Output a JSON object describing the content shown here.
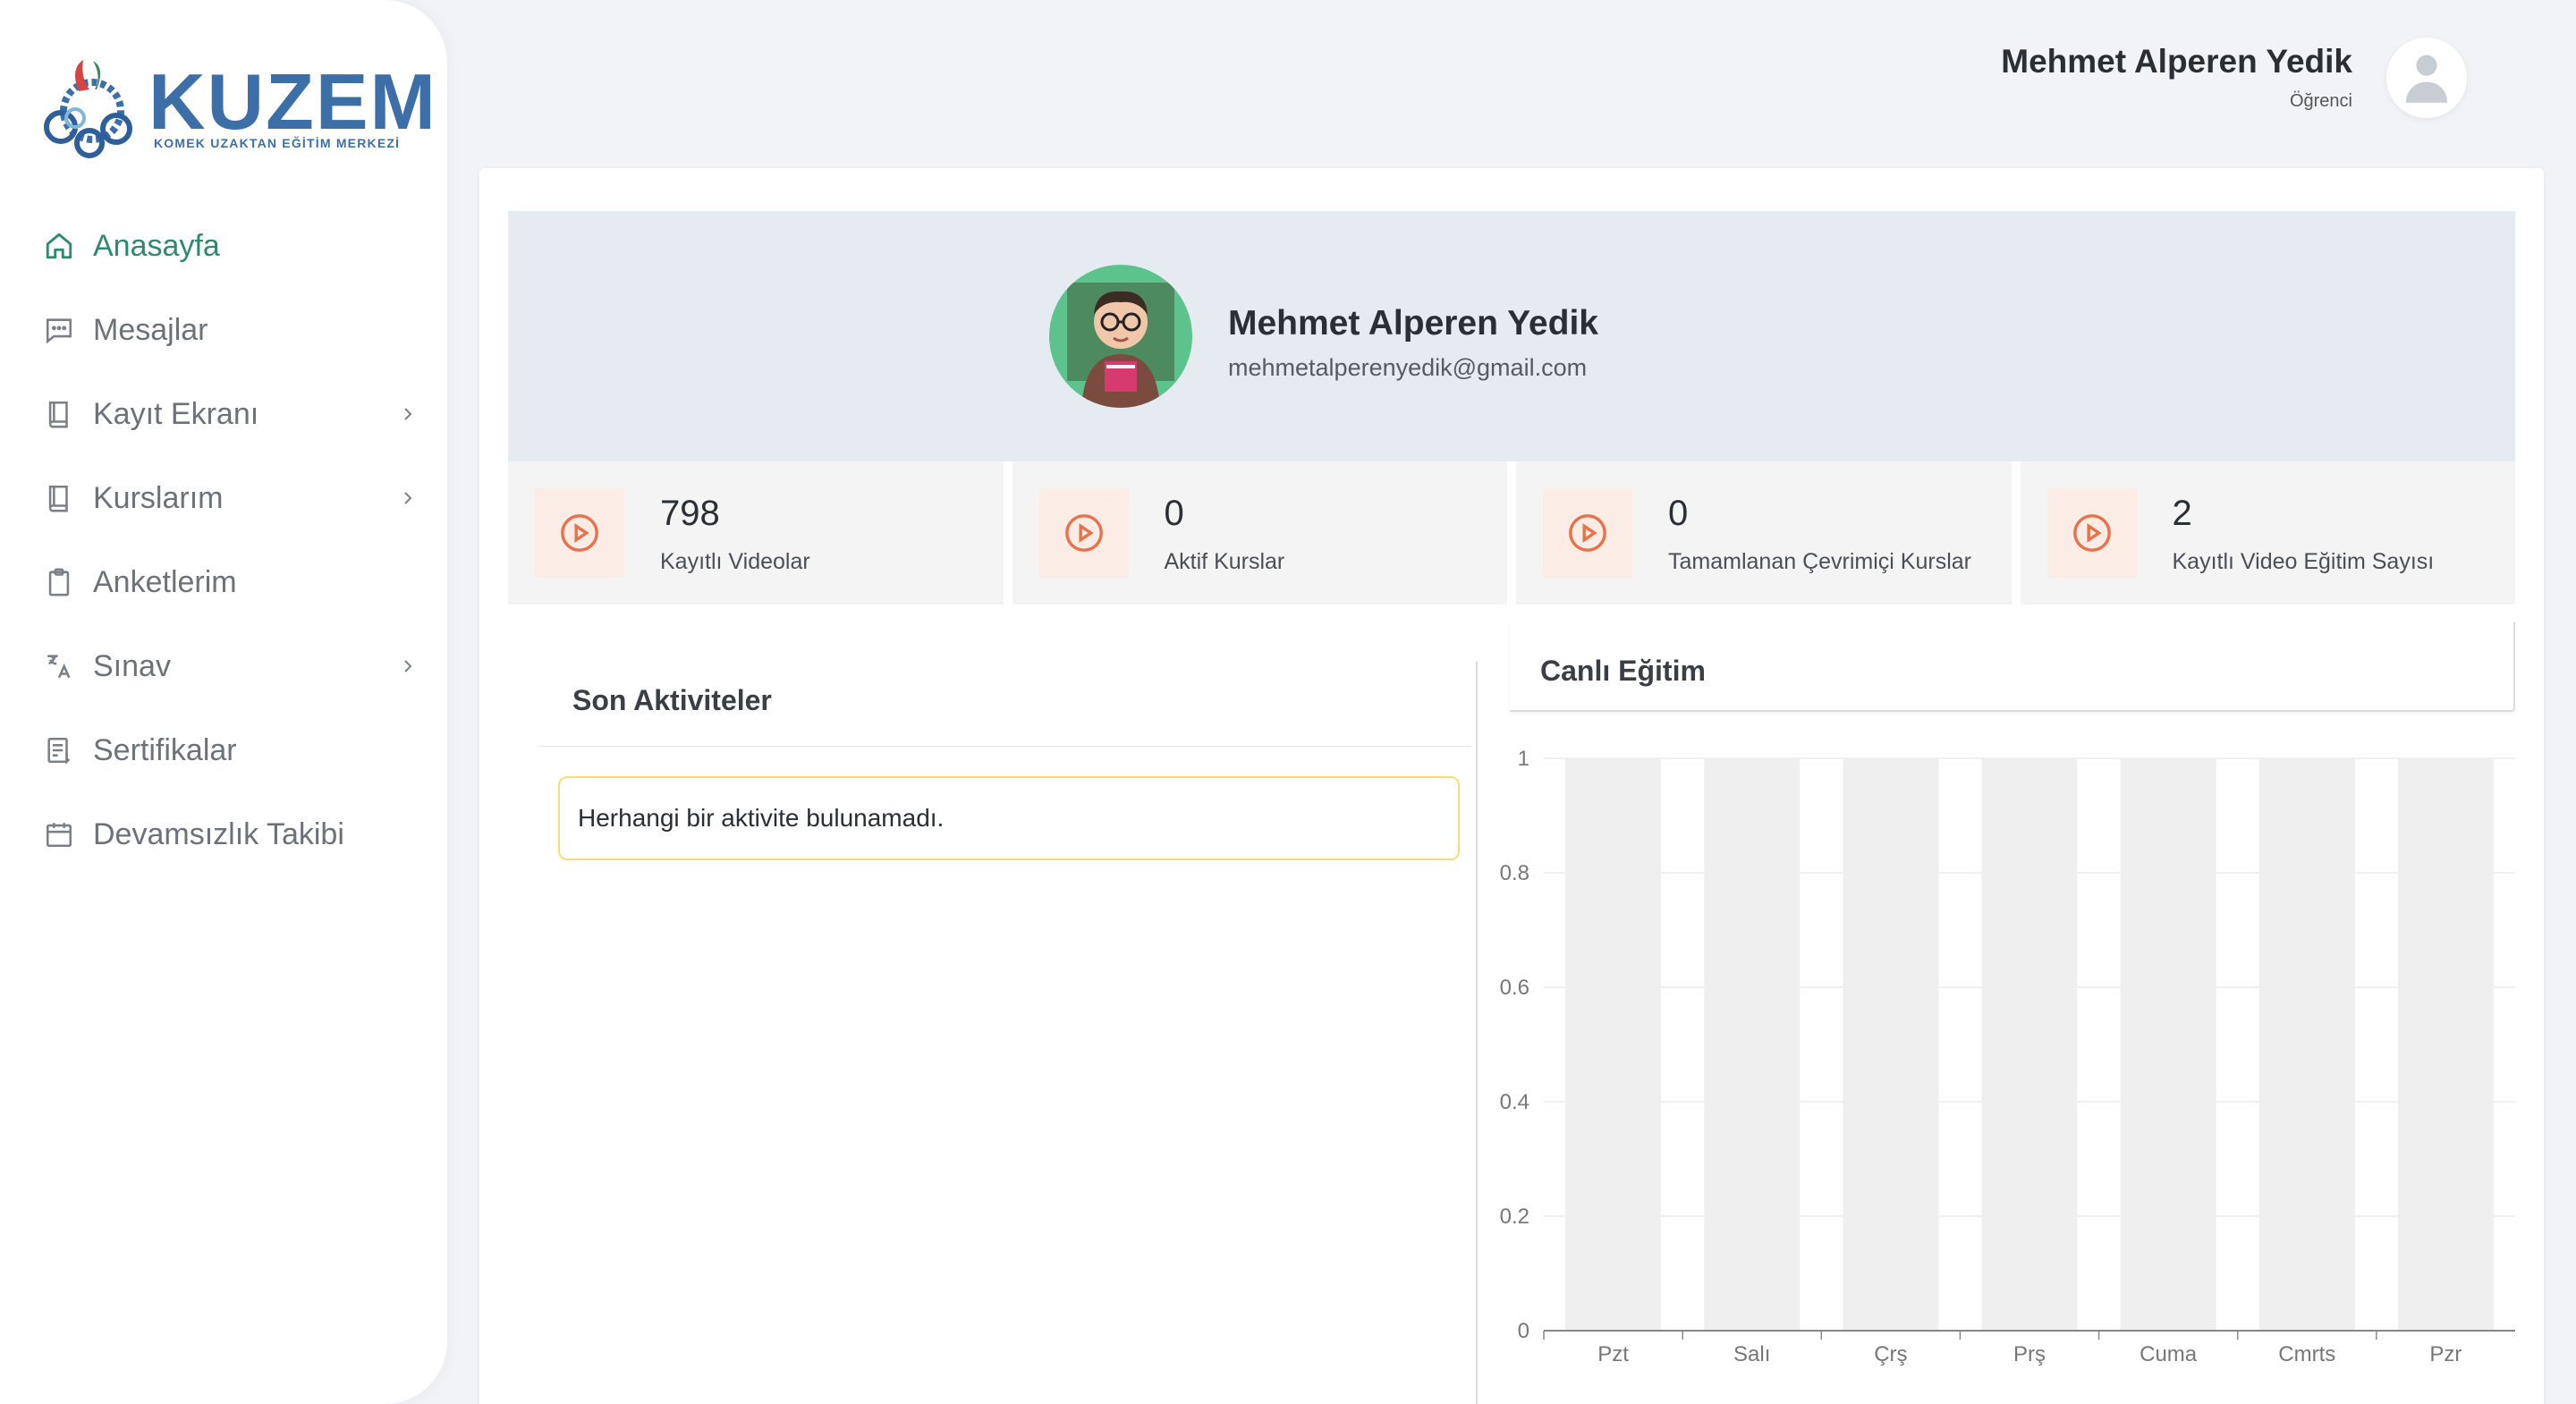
{
  "brand": {
    "name": "KUZEM",
    "subtitle": "KOMEK UZAKTAN EĞİTİM MERKEZİ",
    "blue": "#3c6fa8"
  },
  "sidebar": {
    "items": [
      {
        "label": "Anasayfa",
        "icon": "home-icon",
        "active": true,
        "chevron": false
      },
      {
        "label": "Mesajlar",
        "icon": "message-icon",
        "active": false,
        "chevron": false
      },
      {
        "label": "Kayıt Ekranı",
        "icon": "book-icon",
        "active": false,
        "chevron": true
      },
      {
        "label": "Kurslarım",
        "icon": "book-icon",
        "active": false,
        "chevron": true
      },
      {
        "label": "Anketlerim",
        "icon": "clipboard-icon",
        "active": false,
        "chevron": false
      },
      {
        "label": "Sınav",
        "icon": "translate-icon",
        "active": false,
        "chevron": true
      },
      {
        "label": "Sertifikalar",
        "icon": "certificate-icon",
        "active": false,
        "chevron": false
      },
      {
        "label": "Devamsızlık Takibi",
        "icon": "calendar-icon",
        "active": false,
        "chevron": false
      }
    ],
    "active_color": "#2e8a6e"
  },
  "header": {
    "user_name": "Mehmet Alperen Yedik",
    "user_role": "Öğrenci"
  },
  "profile": {
    "name": "Mehmet Alperen Yedik",
    "email": "mehmetalperenyedik@gmail.com"
  },
  "stats": [
    {
      "value": "798",
      "label": "Kayıtlı Videolar",
      "icon": "play-circle-icon"
    },
    {
      "value": "0",
      "label": "Aktif Kurslar",
      "icon": "play-circle-icon"
    },
    {
      "value": "0",
      "label": "Tamamlanan Çevrimiçi Kurslar",
      "icon": "play-circle-icon"
    },
    {
      "value": "2",
      "label": "Kayıtlı Video Eğitim Sayısı",
      "icon": "play-circle-icon"
    }
  ],
  "activities": {
    "title": "Son Aktiviteler",
    "empty_message": "Herhangi bir aktivite bulunamadı."
  },
  "live": {
    "title": "Canlı Eğitim"
  },
  "chart_data": {
    "type": "bar",
    "title": "",
    "xlabel": "",
    "ylabel": "",
    "categories": [
      "Pzt",
      "Salı",
      "Çrş",
      "Prş",
      "Cuma",
      "Cmrts",
      "Pzr"
    ],
    "values": [
      0,
      0,
      0,
      0,
      0,
      0,
      0
    ],
    "ylim": [
      0,
      1
    ],
    "yticks": [
      "0",
      "0.2",
      "0.4",
      "0.6",
      "0.8",
      "1"
    ],
    "grid": true,
    "background_bar_color": "#efefef"
  }
}
